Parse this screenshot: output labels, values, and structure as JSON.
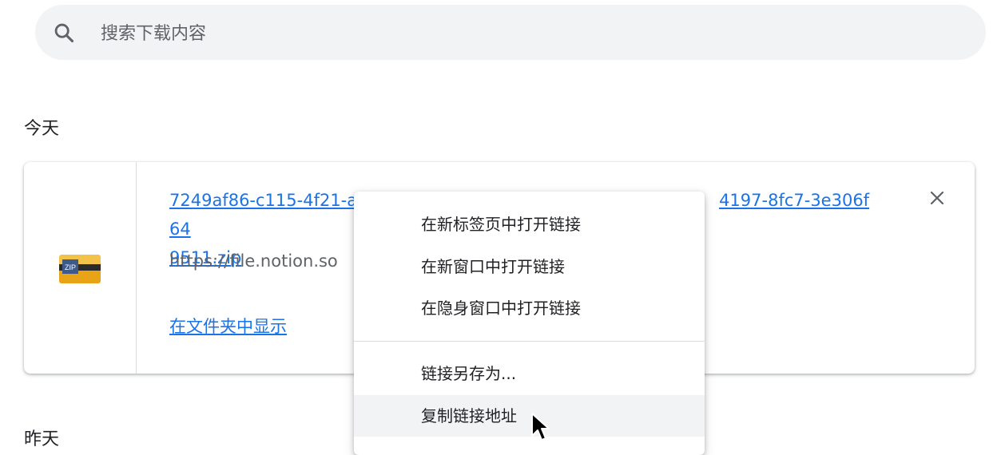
{
  "search": {
    "placeholder": "搜索下载内容"
  },
  "sections": {
    "today": "今天",
    "yesterday": "昨天"
  },
  "download": {
    "filename": "7249af86-c115-4f21-ae█████████████████████████-4197-8fc7-3e306f649511.zip",
    "filename_visible_line1": "7249af86-c115-4f21-ae",
    "filename_visible_line1_end": "4197-8fc7-3e306f64",
    "filename_visible_line2": "9511.zip",
    "source": "https://file.notion.so",
    "show_in_folder": "在文件夹中显示",
    "icon": "zip-archive-icon"
  },
  "context_menu": {
    "items": [
      {
        "label": "在新标签页中打开链接"
      },
      {
        "label": "在新窗口中打开链接"
      },
      {
        "label": "在隐身窗口中打开链接"
      },
      {
        "label": "链接另存为..."
      },
      {
        "label": "复制链接地址"
      }
    ]
  },
  "colors": {
    "link": "#1a73e8",
    "search_bg": "#f1f3f4",
    "menu_highlight": "#f1f3f4"
  }
}
